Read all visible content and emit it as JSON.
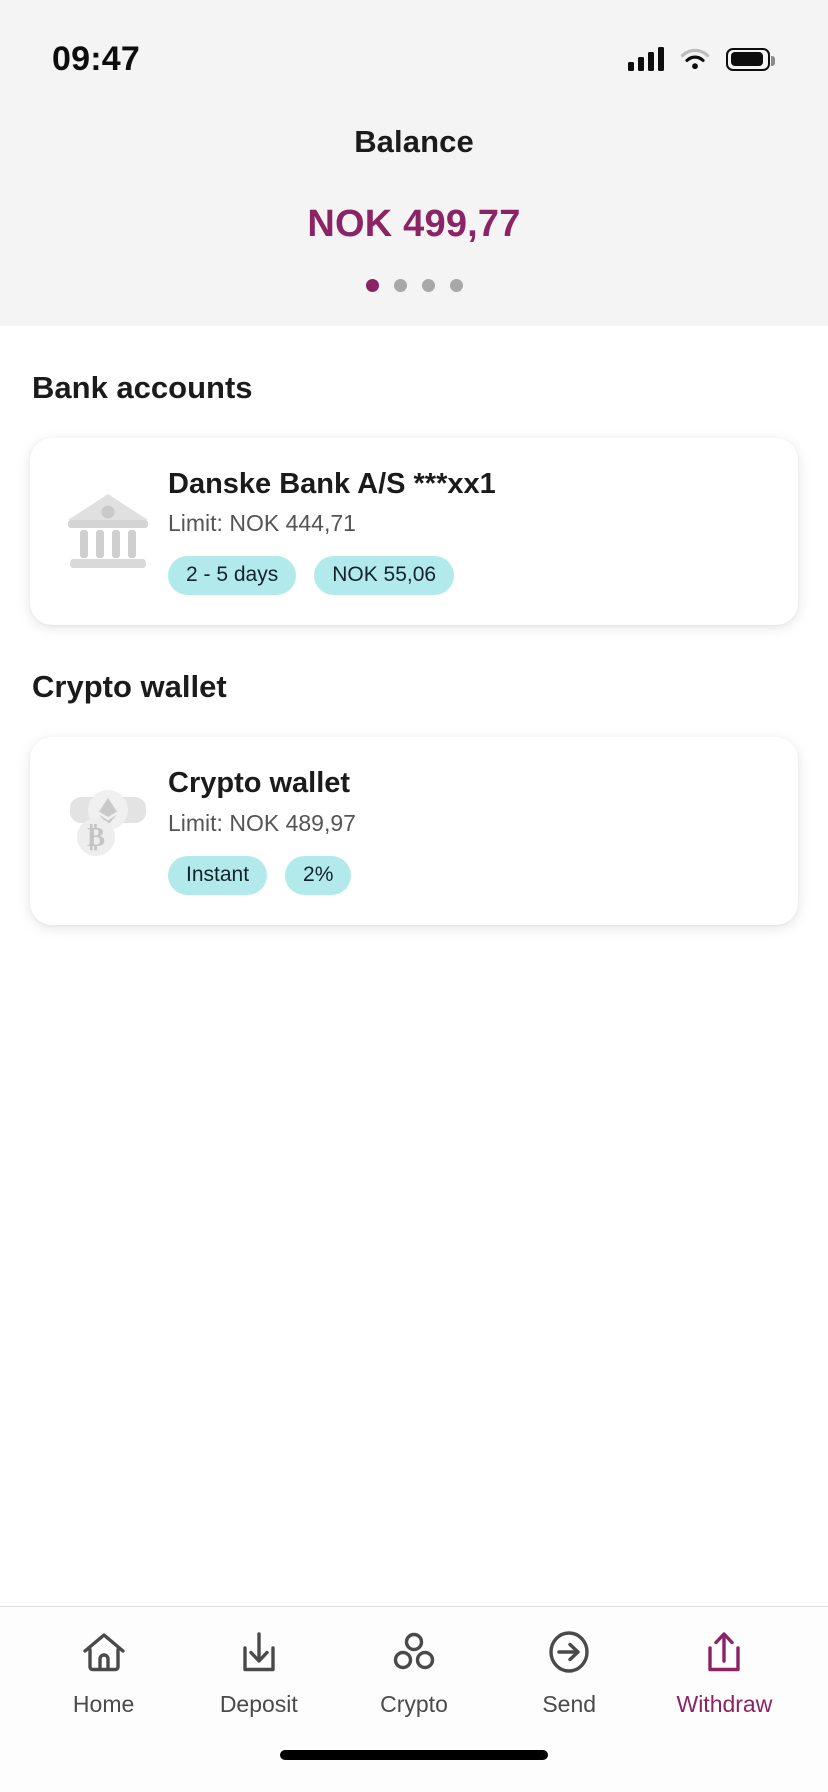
{
  "status_bar": {
    "time": "09:47",
    "cellular_icon": "cellular-signal-icon",
    "wifi_icon": "wifi-icon",
    "battery_icon": "battery-icon"
  },
  "header": {
    "balance_label": "Balance",
    "balance_amount": "NOK 499,77",
    "accent_color": "#8b2464",
    "pager": {
      "total": 4,
      "active_index": 0
    }
  },
  "sections": [
    {
      "title": "Bank accounts",
      "items": [
        {
          "icon": "bank-building-icon",
          "title": "Danske Bank A/S ***xx1",
          "limit": "Limit: NOK 444,71",
          "badges": [
            "2 - 5 days",
            "NOK 55,06"
          ]
        }
      ]
    },
    {
      "title": "Crypto wallet",
      "items": [
        {
          "icon": "crypto-coins-icon",
          "title": "Crypto wallet",
          "limit": "Limit: NOK 489,97",
          "badges": [
            "Instant",
            "2%"
          ]
        }
      ]
    }
  ],
  "badge_color": "#b2eaec",
  "tabbar": {
    "items": [
      {
        "label": "Home",
        "icon": "home-icon",
        "active": false
      },
      {
        "label": "Deposit",
        "icon": "deposit-icon",
        "active": false
      },
      {
        "label": "Crypto",
        "icon": "crypto-icon",
        "active": false
      },
      {
        "label": "Send",
        "icon": "send-icon",
        "active": false
      },
      {
        "label": "Withdraw",
        "icon": "withdraw-icon",
        "active": true
      }
    ]
  }
}
